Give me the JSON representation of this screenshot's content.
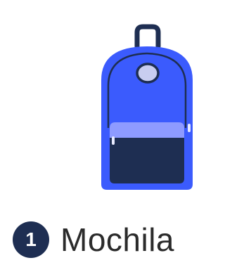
{
  "item": {
    "number": "1",
    "label": "Mochila",
    "icon": "backpack-icon"
  },
  "colors": {
    "backpack_body": "#3b5bfd",
    "backpack_pocket_top": "#8e9bff",
    "backpack_pocket_bottom": "#1e2e52",
    "outline": "#1e2e52",
    "badge": "#1e2e52"
  }
}
